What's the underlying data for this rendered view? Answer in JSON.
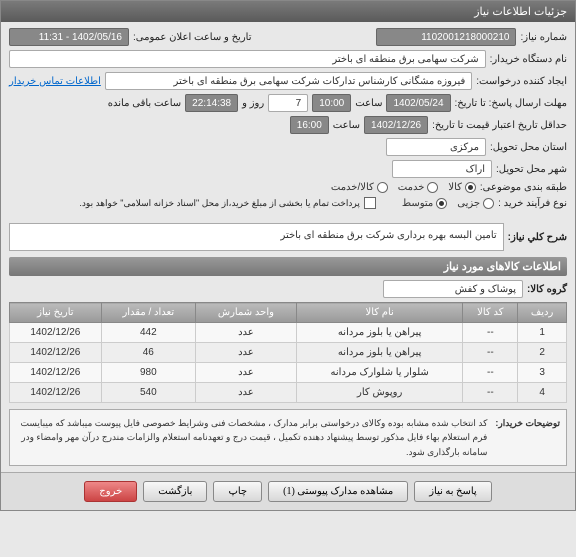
{
  "window_title": "جزئیات اطلاعات نیاز",
  "fields": {
    "need_number_label": "شماره نیاز:",
    "need_number": "1102001218000210",
    "announce_label": "تاریخ و ساعت اعلان عمومی:",
    "announce_value": "1402/05/16 - 11:31",
    "buyer_org_label": "نام دستگاه خریدار:",
    "buyer_org": "شرکت سهامی برق منطقه ای باختر",
    "requester_label": "ایجاد کننده درخواست:",
    "requester": "فیروزه مشگانی کارشناس تدارکات شرکت سهامی برق منطقه ای باختر",
    "contact_link": "اطلاعات تماس خریدار",
    "deadline_send_label": "مهلت ارسال پاسخ: تا تاریخ:",
    "deadline_date": "1402/05/24",
    "time_label": "ساعت",
    "deadline_time": "10:00",
    "days_count": "7",
    "days_label": "روز و",
    "remaining_time": "22:14:38",
    "remaining_label": "ساعت باقی مانده",
    "validity_label": "حداقل تاریخ اعتبار قیمت تا تاریخ:",
    "validity_date": "1402/12/26",
    "validity_time": "16:00",
    "delivery_state_label": "استان محل تحویل:",
    "delivery_state": "مرکزی",
    "delivery_city_label": "شهر محل تحویل:",
    "delivery_city": "اراک",
    "category_label": "طبقه بندی موضوعی:",
    "cat_goods": "کالا",
    "cat_service": "خدمت",
    "cat_both": "کالا/خدمت",
    "process_label": "نوع فرآیند خرید :",
    "proc_small": "جزیی",
    "proc_medium": "متوسط",
    "payment_note": "پرداخت تمام یا بخشی از مبلغ خرید،از محل \"اسناد خزانه اسلامی\" خواهد بود."
  },
  "need_desc_label": "شرح کلي نیاز:",
  "need_desc": "تامین  البسه بهره برداری  شرکت برق منطقه ای باختر",
  "items_section": "اطلاعات کالاهای مورد نیاز",
  "group_label": "گروه کالا:",
  "group_value": "پوشاک و کفش",
  "table": {
    "headers": [
      "ردیف",
      "کد کالا",
      "نام کالا",
      "واحد شمارش",
      "تعداد / مقدار",
      "تاریخ نیاز"
    ],
    "rows": [
      [
        "1",
        "--",
        "پیراهن یا بلوز مردانه",
        "عدد",
        "442",
        "1402/12/26"
      ],
      [
        "2",
        "--",
        "پیراهن یا بلوز مردانه",
        "عدد",
        "46",
        "1402/12/26"
      ],
      [
        "3",
        "--",
        "شلوار یا شلوارک مردانه",
        "عدد",
        "980",
        "1402/12/26"
      ],
      [
        "4",
        "--",
        "روپوش کار",
        "عدد",
        "540",
        "1402/12/26"
      ]
    ]
  },
  "buyer_note_label": "توضیحات خریدار:",
  "buyer_note": "کد انتخاب شده مشابه بوده وکالای درخواستی برابر مدارک ، مشخصات فنی وشرایط خصوصی فایل پیوست میباشد که میبایست فرم استعلام بهاء فایل مذکور توسط پیشنهاد دهنده تکمیل ، قیمت درج و تعهدنامه استعلام والزامات  مندرج درآن مهر وامضاء ودر سامانه بارگذاری شود.",
  "buttons": {
    "respond": "پاسخ به نیاز",
    "attachments": "مشاهده مدارک پیوستی (1)",
    "print": "چاپ",
    "back": "بازگشت",
    "exit": "خروج"
  }
}
